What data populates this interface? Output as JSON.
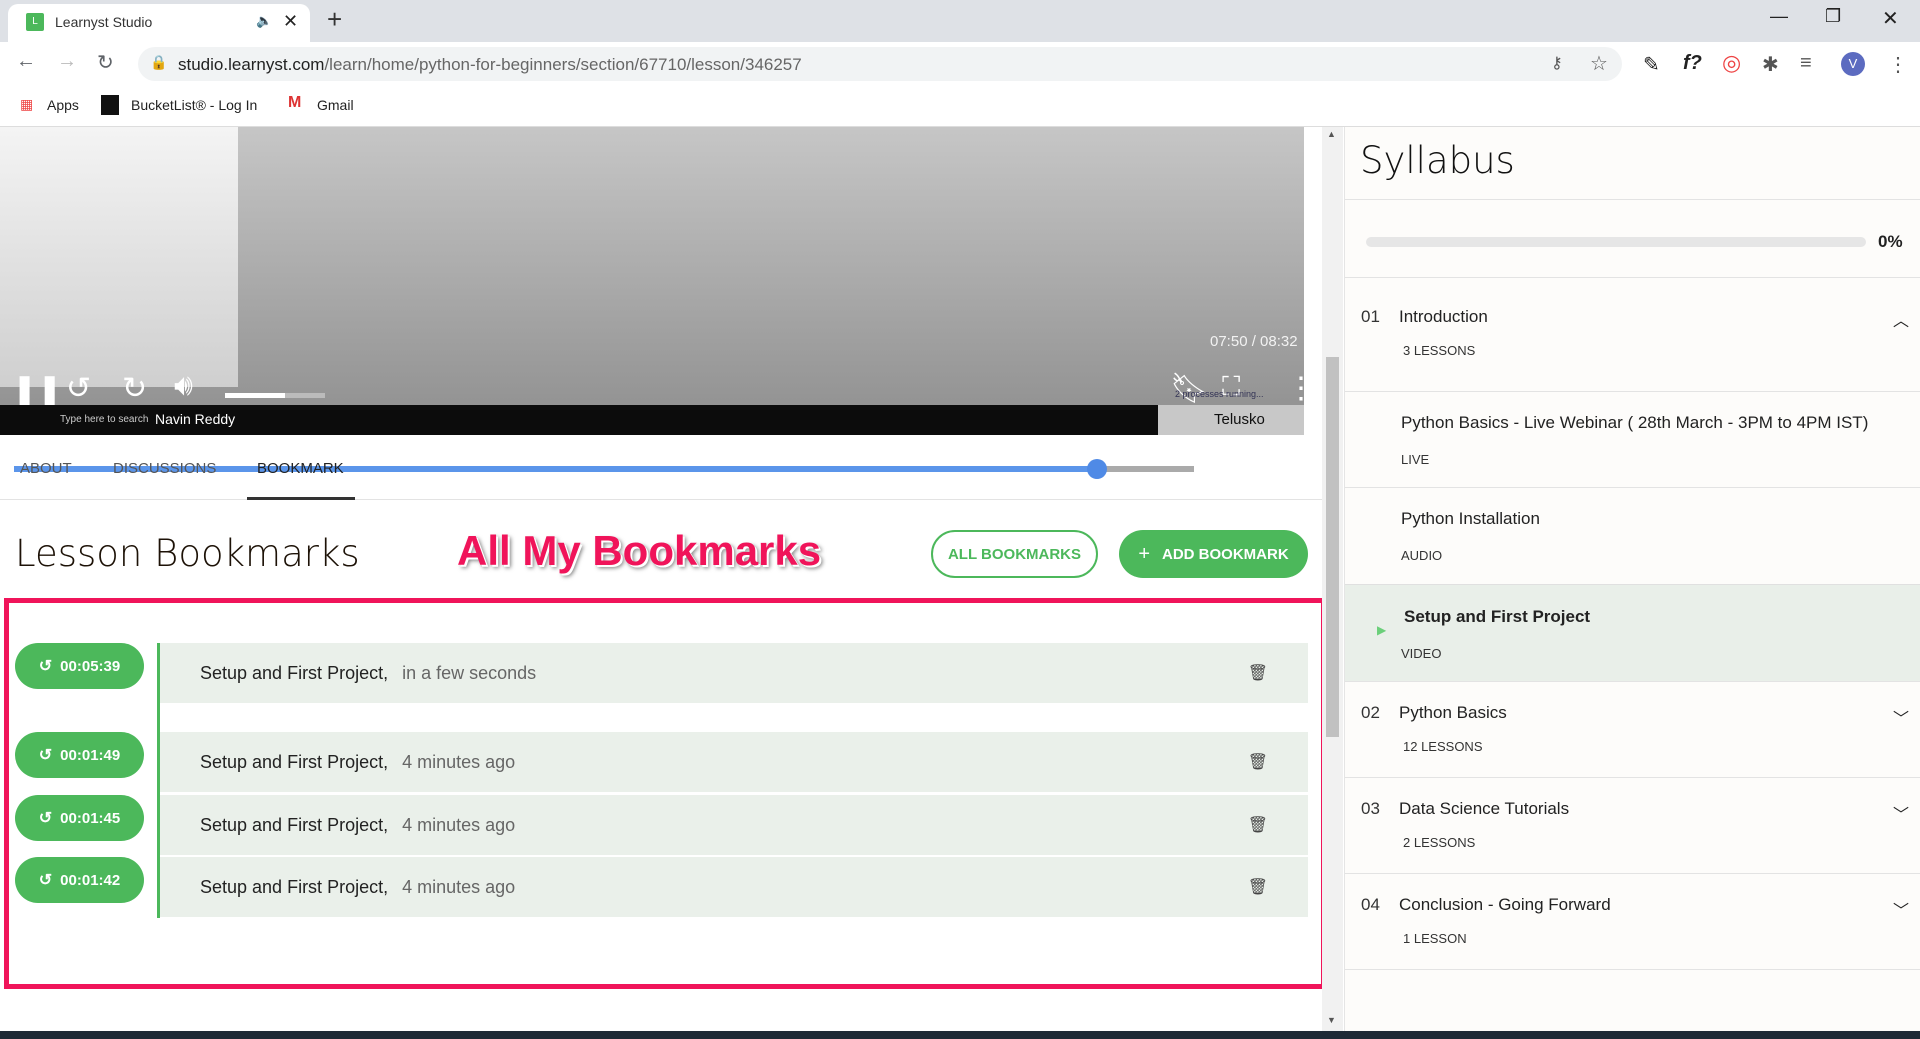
{
  "browser": {
    "tab_title": "Learnyst Studio",
    "new_tab": "+",
    "url_domain": "studio.learnyst.com",
    "url_path": "/learn/home/python-for-beginners/section/67710/lesson/346257",
    "bookmarks": [
      "Apps",
      "BucketList® - Log In",
      "Gmail"
    ],
    "profile_initial": "V"
  },
  "video": {
    "time": "07:50 / 08:32",
    "progress_fraction": 0.918,
    "volume_fraction": 0.6,
    "taskbar_search": "Type here to search",
    "taskbar_user": "Navin Reddy",
    "taskbar_window": "Telusko",
    "processes": "2 processes running...",
    "skip": "10"
  },
  "tabs": [
    "ABOUT",
    "DISCUSSIONS",
    "BOOKMARK"
  ],
  "bookmarks": {
    "title": "Lesson Bookmarks",
    "annotation": "All My Bookmarks",
    "all_button": "ALL BOOKMARKS",
    "add_button": "ADD BOOKMARK",
    "add_icon": "+",
    "items": [
      {
        "time": "00:05:39",
        "lesson": "Setup and First Project,",
        "ago": "in a few seconds"
      },
      {
        "time": "00:01:49",
        "lesson": "Setup and First Project,",
        "ago": "4 minutes ago"
      },
      {
        "time": "00:01:45",
        "lesson": "Setup and First Project,",
        "ago": "4 minutes ago"
      },
      {
        "time": "00:01:42",
        "lesson": "Setup and First Project,",
        "ago": "4 minutes ago"
      }
    ]
  },
  "syllabus": {
    "title": "Syllabus",
    "progress": "0%",
    "sections": [
      {
        "num": "01",
        "title": "Introduction",
        "count": "3 LESSONS",
        "lessons": [
          {
            "title": "Python Basics - Live Webinar ( 28th March - 3PM to 4PM IST)",
            "type": "LIVE"
          },
          {
            "title": "Python Installation",
            "type": "AUDIO"
          },
          {
            "title": "Setup and First Project",
            "type": "VIDEO",
            "active": true
          }
        ]
      },
      {
        "num": "02",
        "title": "Python Basics",
        "count": "12 LESSONS"
      },
      {
        "num": "03",
        "title": "Data Science Tutorials",
        "count": "2 LESSONS"
      },
      {
        "num": "04",
        "title": "Conclusion - Going Forward",
        "count": "1 LESSON"
      }
    ]
  },
  "colors": {
    "accent": "#4cb85b",
    "annotation": "#f0145a",
    "active_lesson_bg": "#e9efe9"
  }
}
